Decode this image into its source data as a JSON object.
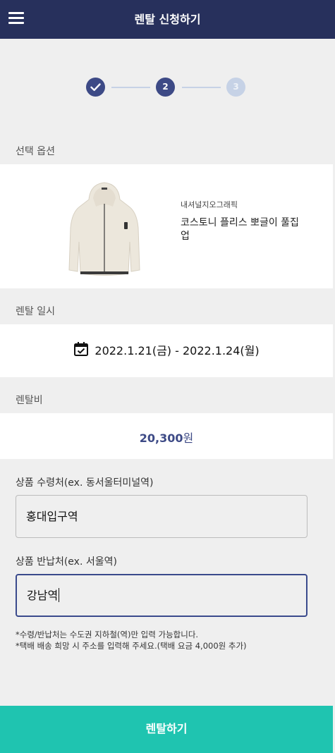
{
  "header": {
    "title": "렌탈 신청하기"
  },
  "stepper": {
    "step2": "2",
    "step3": "3"
  },
  "sections": {
    "option_label": "선택 옵션",
    "date_label": "렌탈 일시",
    "fee_label": "렌탈비"
  },
  "product": {
    "brand": "내셔널지오그래픽",
    "name": "코스토니 플리스 뽀글이 풀집업"
  },
  "rental": {
    "date_range": "2022.1.21(금) - 2022.1.24(월)",
    "price_value": "20,300",
    "price_unit": "원"
  },
  "form": {
    "pickup_label": "상품 수령처(ex. 동서울터미널역)",
    "pickup_value": "홍대입구역",
    "return_label": "상품 반납처(ex. 서울역)",
    "return_value": "강남역"
  },
  "notes": {
    "line1": "*수령/반납처는 수도권 지하철(역)만 입력 가능합니다.",
    "line2": "*택배 배송 희망 시 주소를 입력해 주세요.(택배 요금 4,000원 추가)"
  },
  "footer": {
    "submit_label": "렌탈하기"
  },
  "colors": {
    "header_bg": "#27305c",
    "accent": "#3d4a86",
    "submit_bg": "#1fc4b0"
  },
  "icons": {
    "menu": "hamburger-menu-icon",
    "check": "check-icon",
    "calendar": "calendar-check-icon"
  }
}
